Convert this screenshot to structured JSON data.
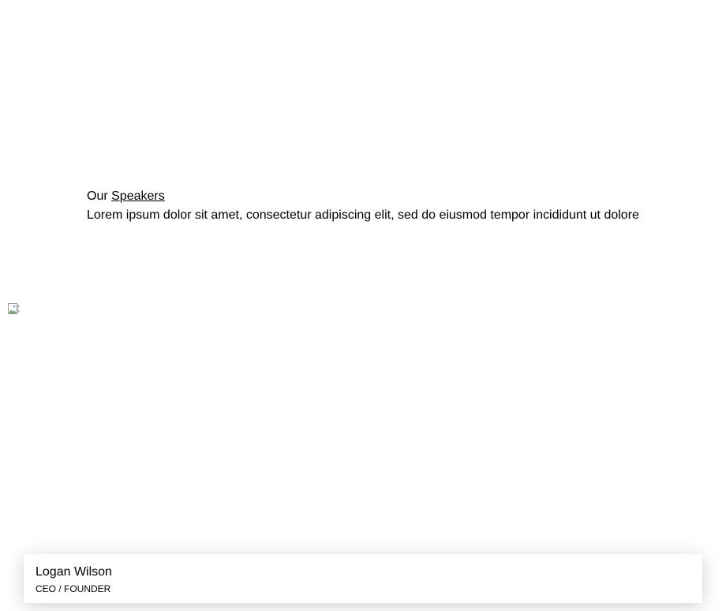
{
  "section": {
    "heading_prefix": "Our",
    "heading_link": "Speakers",
    "intro": "Lorem ipsum dolor sit amet, consectetur adipiscing elit, sed do eiusmod tempor incididunt ut dolore"
  },
  "image": {
    "icon": "broken-image-icon"
  },
  "speaker": {
    "name": "Logan Wilson",
    "role": "CEO / FOUNDER"
  }
}
